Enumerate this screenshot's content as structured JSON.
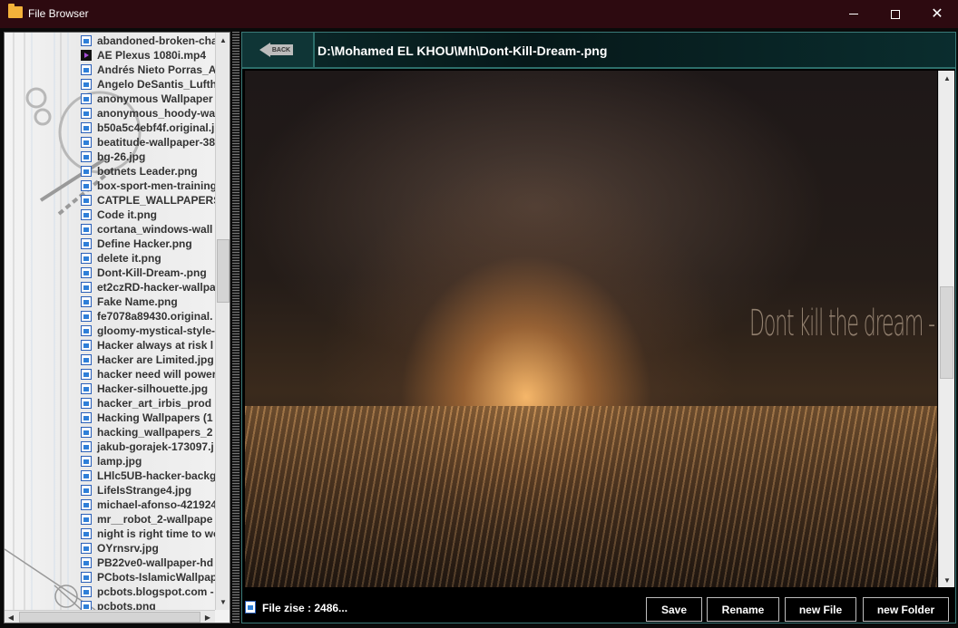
{
  "window": {
    "title": "File Browser",
    "minimize_icon": "minimize-icon",
    "maximize_icon": "maximize-icon",
    "close_icon": "close-icon",
    "close_glyph": "✕"
  },
  "file_list": {
    "items": [
      {
        "name": "abandoned-broken-cha",
        "type": "image"
      },
      {
        "name": "AE Plexus 1080i.mp4",
        "type": "video"
      },
      {
        "name": "Andrés Nieto Porras_A",
        "type": "image"
      },
      {
        "name": "Angelo DeSantis_Lufth",
        "type": "image"
      },
      {
        "name": "anonymous Wallpaper",
        "type": "image"
      },
      {
        "name": "anonymous_hoody-wa",
        "type": "image"
      },
      {
        "name": "b50a5c4ebf4f.original.j",
        "type": "image"
      },
      {
        "name": "beatitude-wallpaper-38",
        "type": "image"
      },
      {
        "name": "bg-26.jpg",
        "type": "image"
      },
      {
        "name": "botnets Leader.png",
        "type": "image"
      },
      {
        "name": "box-sport-men-training",
        "type": "image"
      },
      {
        "name": "CATPLE_WALLPAPERS",
        "type": "image"
      },
      {
        "name": "Code it.png",
        "type": "image"
      },
      {
        "name": "cortana_windows-wall",
        "type": "image"
      },
      {
        "name": "Define Hacker.png",
        "type": "image"
      },
      {
        "name": "delete it.png",
        "type": "image"
      },
      {
        "name": "Dont-Kill-Dream-.png",
        "type": "image"
      },
      {
        "name": "et2czRD-hacker-wallpa",
        "type": "image"
      },
      {
        "name": "Fake Name.png",
        "type": "image"
      },
      {
        "name": "fe7078a89430.original.",
        "type": "image"
      },
      {
        "name": "gloomy-mystical-style-",
        "type": "image"
      },
      {
        "name": "Hacker always at risk l",
        "type": "image"
      },
      {
        "name": "Hacker are Limited.jpg",
        "type": "image"
      },
      {
        "name": "hacker need will power",
        "type": "image"
      },
      {
        "name": "Hacker-silhouette.jpg",
        "type": "image"
      },
      {
        "name": "hacker_art_irbis_prod",
        "type": "image"
      },
      {
        "name": "Hacking Wallpapers (1",
        "type": "image"
      },
      {
        "name": "hacking_wallpapers_2",
        "type": "image"
      },
      {
        "name": "jakub-gorajek-173097.j",
        "type": "image"
      },
      {
        "name": "lamp.jpg",
        "type": "image"
      },
      {
        "name": "LHlc5UB-hacker-backg",
        "type": "image"
      },
      {
        "name": "LifeIsStrange4.jpg",
        "type": "image"
      },
      {
        "name": "michael-afonso-421924",
        "type": "image"
      },
      {
        "name": "mr__robot_2-wallpape",
        "type": "image"
      },
      {
        "name": "night is right time to wo",
        "type": "image"
      },
      {
        "name": "OYrnsrv.jpg",
        "type": "image"
      },
      {
        "name": "PB22ve0-wallpaper-hd",
        "type": "image"
      },
      {
        "name": "PCbots-IslamicWallpap",
        "type": "image"
      },
      {
        "name": "pcbots.blogspot.com -",
        "type": "image"
      },
      {
        "name": "pcbots.png",
        "type": "image"
      }
    ],
    "file_icon": "image-file-icon",
    "video_icon": "video-file-icon",
    "scroll_up_glyph": "▲",
    "scroll_down_glyph": "▼",
    "scroll_left_glyph": "◀",
    "scroll_right_glyph": "▶"
  },
  "viewer": {
    "back_label": "BACK",
    "back_icon": "back-arrow-icon",
    "path": "D:\\Mohamed EL KHOU\\Mh\\Dont-Kill-Dream-.png",
    "image_overlay_text": "Dont kill the dream - execute",
    "scroll_up_glyph": "▲",
    "scroll_down_glyph": "▼"
  },
  "status": {
    "icon": "image-file-icon",
    "file_size_text": "File zise : 2486..."
  },
  "toolbar": {
    "save_label": "Save",
    "rename_label": "Rename",
    "new_file_label": "new File",
    "new_folder_label": "new Folder"
  },
  "colors": {
    "titlebar": "#2d0a10",
    "header_accent": "#2c6e6a",
    "file_icon_blue": "#2f7fd8"
  }
}
